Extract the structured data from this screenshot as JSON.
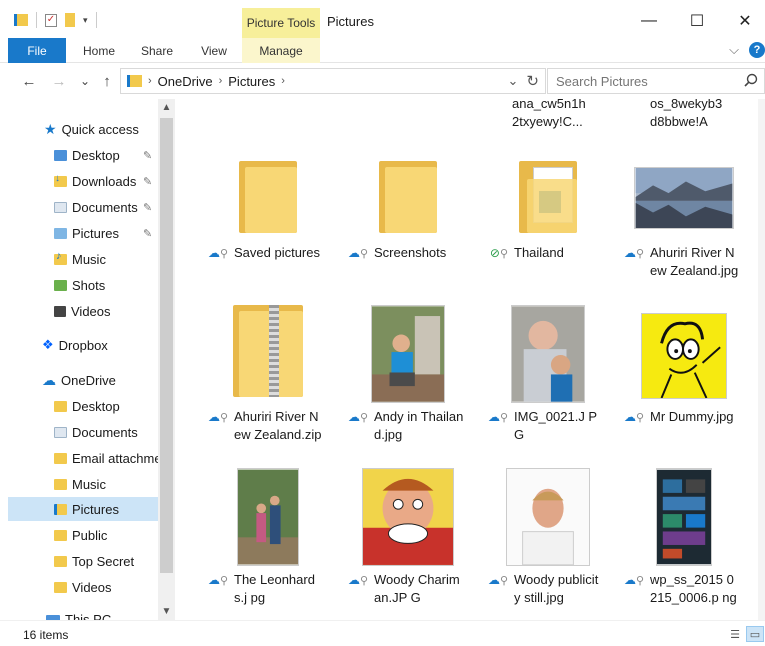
{
  "window": {
    "context_tab": "Picture Tools",
    "title": "Pictures",
    "minimize": "—",
    "maximize": "☐",
    "close": "✕"
  },
  "ribbon": {
    "tabs": [
      {
        "label": "File"
      },
      {
        "label": "Home"
      },
      {
        "label": "Share"
      },
      {
        "label": "View"
      },
      {
        "label": "Manage"
      }
    ],
    "expand": "⌵",
    "help": "?"
  },
  "nav": {
    "back": "←",
    "forward": "→",
    "recent": "⌄",
    "up": "↑",
    "breadcrumb": [
      "OneDrive",
      "Pictures"
    ],
    "crumb_sep": "›",
    "dropdown": "⌄",
    "refresh": "↻",
    "search_placeholder": "Search Pictures",
    "search_icon": "⌕"
  },
  "sidebar": {
    "items": [
      {
        "label": "Quick access",
        "icon": "star-icon",
        "pinned": false
      },
      {
        "label": "Desktop",
        "icon": "folder-icon",
        "pinned": true
      },
      {
        "label": "Downloads",
        "icon": "downloads-icon",
        "pinned": true
      },
      {
        "label": "Documents",
        "icon": "documents-icon",
        "pinned": true
      },
      {
        "label": "Pictures",
        "icon": "pictures-icon",
        "pinned": true
      },
      {
        "label": "Music",
        "icon": "music-icon",
        "pinned": false
      },
      {
        "label": "Shots",
        "icon": "folder-icon",
        "pinned": false
      },
      {
        "label": "Videos",
        "icon": "videos-icon",
        "pinned": false
      },
      {
        "label": "Dropbox",
        "icon": "dropbox-icon",
        "pinned": false
      },
      {
        "label": "OneDrive",
        "icon": "cloud-icon",
        "pinned": false
      },
      {
        "label": "Desktop",
        "icon": "folder-icon",
        "pinned": false
      },
      {
        "label": "Documents",
        "icon": "documents-icon",
        "pinned": false
      },
      {
        "label": "Email attachme",
        "icon": "folder-icon",
        "pinned": false
      },
      {
        "label": "Music",
        "icon": "folder-icon",
        "pinned": false
      },
      {
        "label": "Pictures",
        "icon": "pictures-icon",
        "pinned": false,
        "selected": true
      },
      {
        "label": "Public",
        "icon": "folder-icon",
        "pinned": false
      },
      {
        "label": "Top Secret",
        "icon": "folder-icon",
        "pinned": false
      },
      {
        "label": "Videos",
        "icon": "folder-icon",
        "pinned": false
      },
      {
        "label": "This PC",
        "icon": "pc-icon",
        "pinned": false
      }
    ],
    "pin_glyph": "✎"
  },
  "files": {
    "partial": [
      {
        "name": "ana_cw5n1h 2txyewy!C..."
      },
      {
        "name": "os_8wekyb3 d8bbwe!A"
      }
    ],
    "items": [
      {
        "name": "Saved pictures",
        "kind": "folder",
        "status": "cloud-icon"
      },
      {
        "name": "Screenshots",
        "kind": "folder",
        "status": "cloud-icon"
      },
      {
        "name": "Thailand",
        "kind": "folder-docs",
        "status": "synced-check-icon"
      },
      {
        "name": "Ahuriri River New Zealand.jpg",
        "kind": "photo-landscape",
        "status": "cloud-icon"
      },
      {
        "name": "Ahuriri River New Zealand.zip",
        "kind": "zip",
        "status": "cloud-icon"
      },
      {
        "name": "Andy in Thailand.jpg",
        "kind": "photo-child",
        "status": "cloud-icon"
      },
      {
        "name": "IMG_0021.J PG",
        "kind": "photo-family",
        "status": "cloud-icon"
      },
      {
        "name": "Mr Dummy.jpg",
        "kind": "photo-cartoon",
        "status": "cloud-icon"
      },
      {
        "name": "The Leonhards.j pg",
        "kind": "photo-couple",
        "status": "cloud-icon"
      },
      {
        "name": "Woody Chariman.JP G",
        "kind": "photo-illustration",
        "status": "cloud-icon"
      },
      {
        "name": "Woody publicity still.jpg",
        "kind": "photo-portrait",
        "status": "cloud-icon"
      },
      {
        "name": "wp_ss_2015 0215_0006.p ng",
        "kind": "photo-phone",
        "status": "cloud-icon"
      }
    ],
    "cloud_glyph": "☁",
    "check_glyph": "✓",
    "person_glyph": "⚲"
  },
  "status": {
    "count": "16 items"
  },
  "colors": {
    "accent": "#1979ca",
    "selection": "#cce4f7",
    "folder": "#f8d775",
    "manage_tab": "#f7ef9a"
  }
}
